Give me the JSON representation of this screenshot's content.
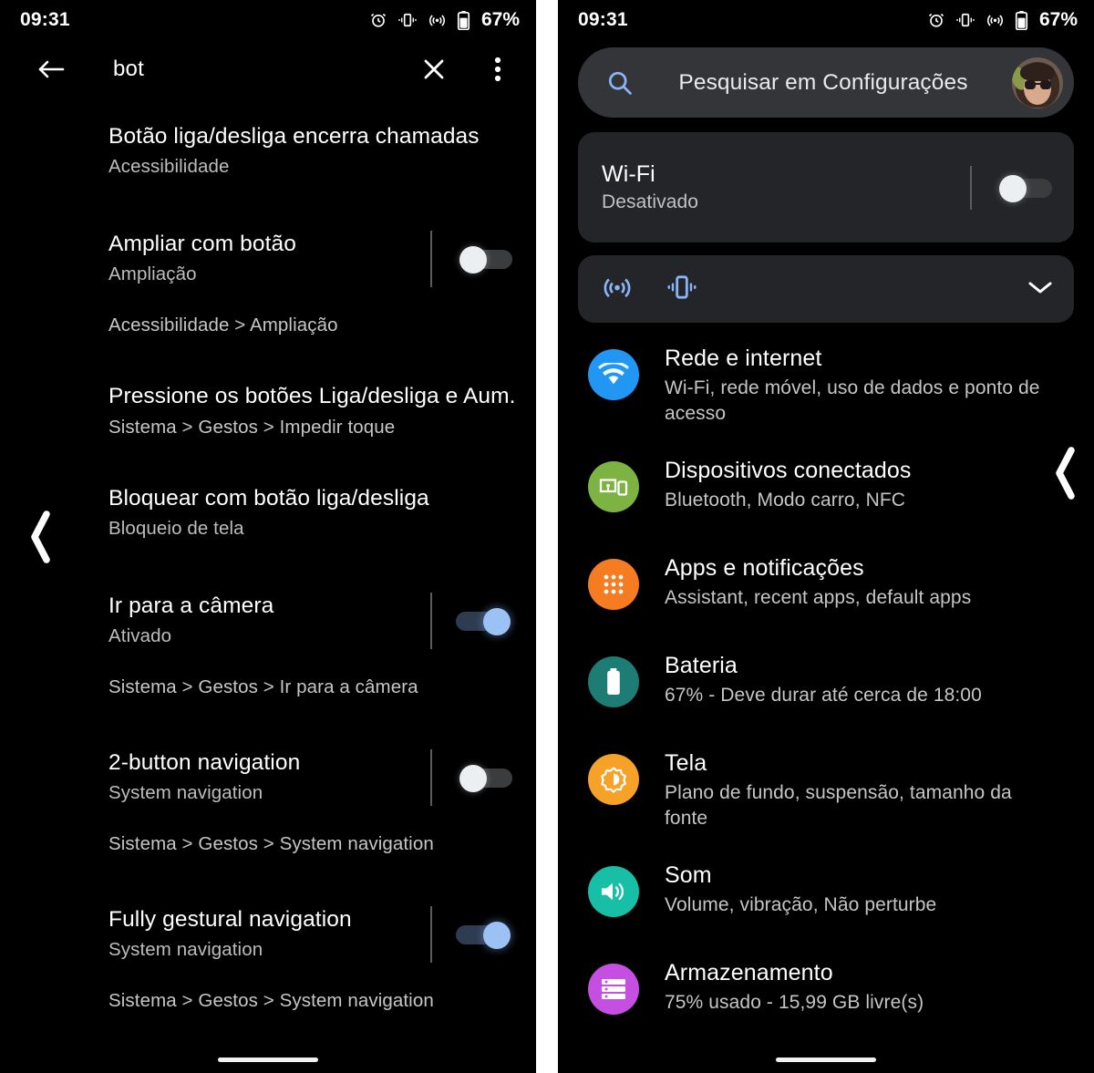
{
  "status_bar": {
    "time": "09:31",
    "battery_percent": "67%",
    "icons": [
      "alarm-icon",
      "vibrate-icon",
      "hotspot-icon",
      "battery-icon"
    ]
  },
  "left_phone": {
    "appbar": {
      "back_label": "back-arrow",
      "query": "bot",
      "clear_label": "clear",
      "overflow_label": "more-options"
    },
    "results": [
      {
        "title": "Botão liga/desliga encerra chamadas",
        "subtitle": "Acessibilidade",
        "breadcrumb": "",
        "toggle": "none"
      },
      {
        "title": "Ampliar com botão",
        "subtitle": "Ampliação",
        "breadcrumb": "Acessibilidade > Ampliação",
        "toggle": "off"
      },
      {
        "title": "Pressione os botões Liga/desliga e Aum..",
        "subtitle": "",
        "breadcrumb": "Sistema > Gestos > Impedir toque",
        "toggle": "none"
      },
      {
        "title": "Bloquear com botão liga/desliga",
        "subtitle": "Bloqueio de tela",
        "breadcrumb": "",
        "toggle": "none"
      },
      {
        "title": "Ir para a câmera",
        "subtitle": "Ativado",
        "breadcrumb": "Sistema > Gestos > Ir para a câmera",
        "toggle": "on"
      },
      {
        "title": "2-button navigation",
        "subtitle": "System navigation",
        "breadcrumb": "Sistema > Gestos > System navigation",
        "toggle": "off"
      },
      {
        "title": "Fully gestural navigation",
        "subtitle": "System navigation",
        "breadcrumb": "Sistema > Gestos > System navigation",
        "toggle": "on"
      }
    ]
  },
  "right_phone": {
    "search": {
      "placeholder": "Pesquisar em Configurações",
      "icon": "search-icon",
      "avatar": "user-avatar"
    },
    "wifi_card": {
      "title": "Wi-Fi",
      "subtitle": "Desativado",
      "toggle": "off"
    },
    "quick_settings": {
      "icons": [
        "hotspot-icon",
        "vibrate-icon"
      ],
      "expand": "chevron-down-icon"
    },
    "settings": [
      {
        "icon": "wifi-icon",
        "color": "#2196F3",
        "title": "Rede e internet",
        "subtitle": "Wi-Fi, rede móvel, uso de dados e ponto de acesso"
      },
      {
        "icon": "connected-devices-icon",
        "color": "#7CB342",
        "title": "Dispositivos conectados",
        "subtitle": "Bluetooth, Modo carro, NFC"
      },
      {
        "icon": "apps-grid-icon",
        "color": "#F57C20",
        "title": "Apps e notificações",
        "subtitle": "Assistant, recent apps, default apps"
      },
      {
        "icon": "battery-icon",
        "color": "#1D7D74",
        "title": "Bateria",
        "subtitle": "67% - Deve durar até cerca de 18:00"
      },
      {
        "icon": "brightness-icon",
        "color": "#F6A128",
        "title": "Tela",
        "subtitle": "Plano de fundo, suspensão, tamanho da fonte"
      },
      {
        "icon": "volume-icon",
        "color": "#16BFA6",
        "title": "Som",
        "subtitle": "Volume, vibração, Não perturbe"
      },
      {
        "icon": "storage-icon",
        "color": "#C44FE0",
        "title": "Armazenamento",
        "subtitle": "75% usado - 15,99 GB livre(s)"
      }
    ]
  }
}
